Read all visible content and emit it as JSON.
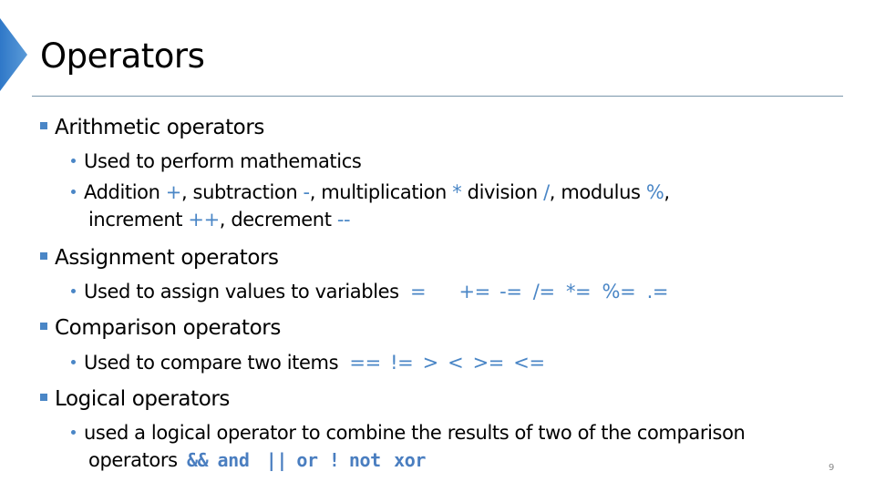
{
  "slide": {
    "title": "Operators",
    "page_number": "9",
    "accent_color": "#4a86c6"
  },
  "sections": [
    {
      "heading": "Arithmetic operators",
      "bullets": [
        {
          "text": "Used to perform mathematics"
        },
        {
          "parts": [
            "Addition ",
            "+",
            ", subtraction ",
            "-",
            ", multiplication ",
            "*",
            " division ",
            "/",
            ", modulus ",
            "%",
            ","
          ],
          "continuation": [
            "increment ",
            "++",
            ", decrement ",
            "--"
          ]
        }
      ]
    },
    {
      "heading": "Assignment operators",
      "bullets": [
        {
          "text": "Used to assign values to variables",
          "operators": [
            "=",
            "+=",
            "-=",
            "/=",
            "*=",
            "%=",
            ".="
          ]
        }
      ]
    },
    {
      "heading": "Comparison operators",
      "bullets": [
        {
          "text": "Used to compare two items",
          "operators": [
            "==",
            "!=",
            ">",
            "<",
            ">=",
            "<="
          ]
        }
      ]
    },
    {
      "heading": "Logical operators",
      "bullets": [
        {
          "text": "used a logical operator to combine the results of two of the comparison",
          "continuation": "operators",
          "operators": [
            "&&",
            "and",
            "||",
            "or",
            "!",
            "not",
            "xor"
          ]
        }
      ]
    }
  ]
}
